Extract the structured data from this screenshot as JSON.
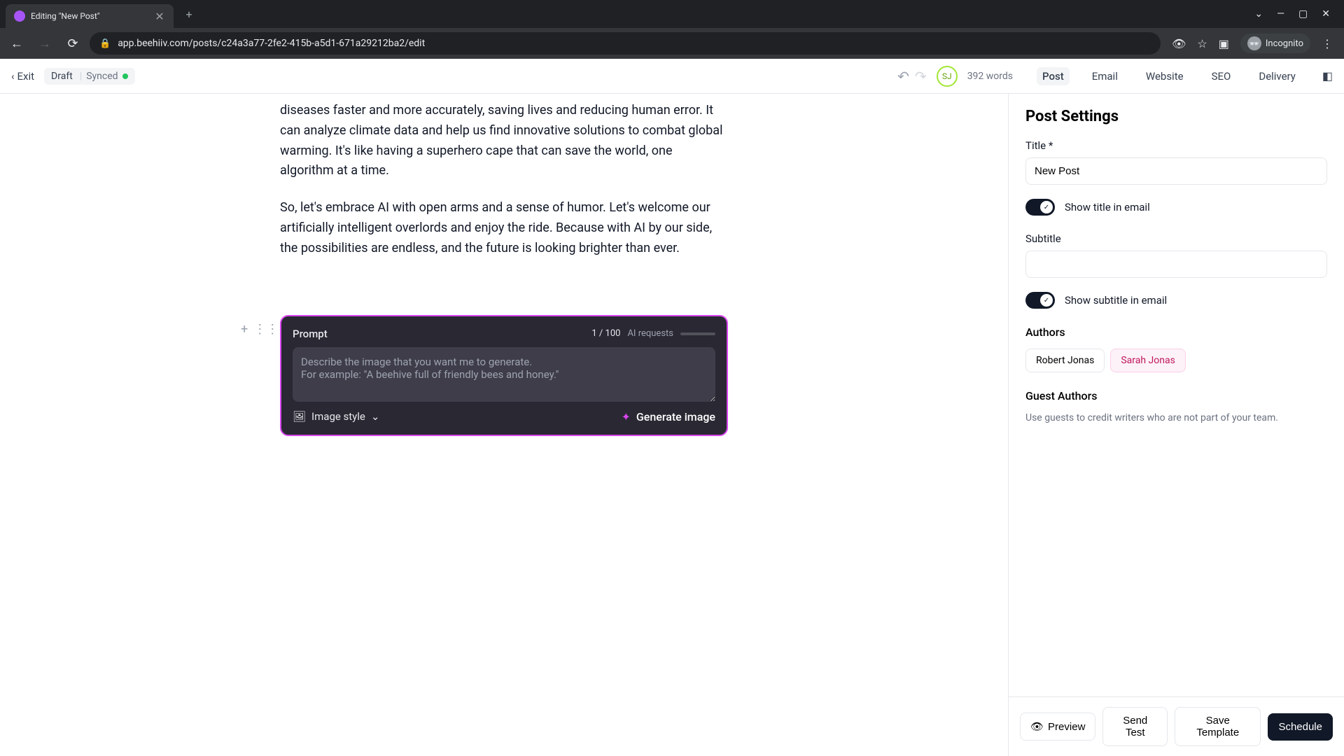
{
  "browser": {
    "tab_title": "Editing \"New Post\"",
    "url": "app.beehiiv.com/posts/c24a3a77-2fe2-415b-a5d1-671a29212ba2/edit",
    "incognito_label": "Incognito"
  },
  "topbar": {
    "exit": "Exit",
    "draft": "Draft",
    "synced": "Synced",
    "avatar_initials": "SJ",
    "word_count": "392 words",
    "tabs": [
      "Post",
      "Email",
      "Website",
      "SEO",
      "Delivery"
    ],
    "active_tab_index": 0
  },
  "editor": {
    "para1": "diseases faster and more accurately, saving lives and reducing human error. It can analyze climate data and help us find innovative solutions to combat global warming. It's like having a superhero cape that can save the world, one algorithm at a time.",
    "para2": "So, let's embrace AI with open arms and a sense of humor. Let's welcome our artificially intelligent overlords and enjoy the ride. Because with AI by our side, the possibilities are endless, and the future is looking brighter than ever."
  },
  "ai_prompt": {
    "label": "Prompt",
    "counter": "1 / 100",
    "requests_label": "AI requests",
    "placeholder": "Describe the image that you want me to generate.\nFor example: \"A beehive full of friendly bees and honey.\"",
    "image_style": "Image style",
    "generate": "Generate image"
  },
  "sidebar": {
    "heading": "Post Settings",
    "title_label": "Title *",
    "title_value": "New Post",
    "show_title_label": "Show title in email",
    "subtitle_label": "Subtitle",
    "subtitle_value": "",
    "show_subtitle_label": "Show subtitle in email",
    "authors_label": "Authors",
    "authors": [
      "Robert Jonas",
      "Sarah Jonas"
    ],
    "guest_label": "Guest Authors",
    "guest_hint": "Use guests to credit writers who are not part of your team.",
    "footer": {
      "preview": "Preview",
      "send_test": "Send Test",
      "save_template": "Save Template",
      "schedule": "Schedule"
    }
  }
}
